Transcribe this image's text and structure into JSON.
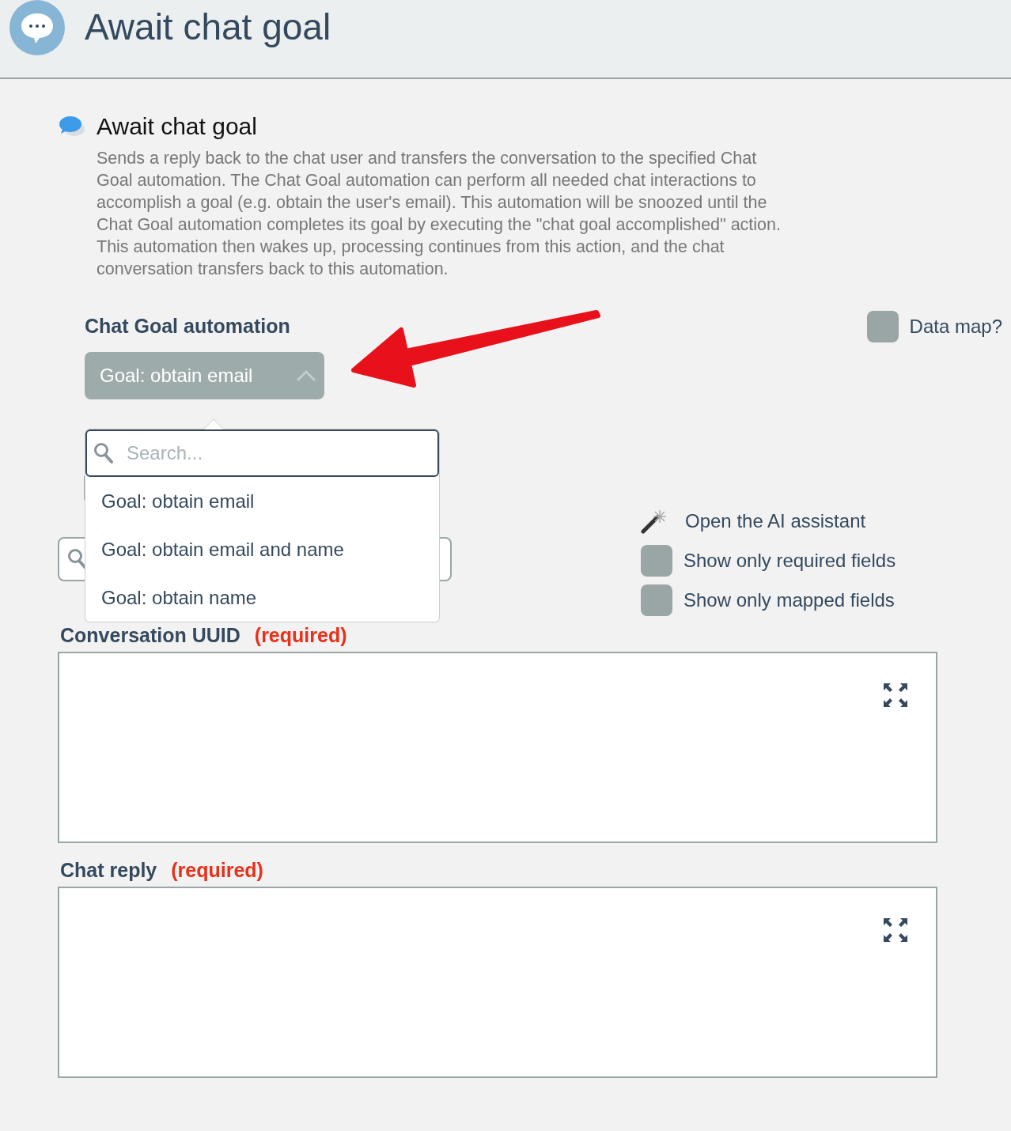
{
  "header": {
    "title": "Await chat goal"
  },
  "action": {
    "title": "Await chat goal",
    "description": "Sends a reply back to the chat user and transfers the conversation to the specified Chat Goal automation. The Chat Goal automation can perform all needed chat interactions to accomplish a goal (e.g. obtain the user's email). This automation will be snoozed until the Chat Goal automation completes its goal by executing the \"chat goal accomplished\" action. This automation then wakes up, processing continues from this action, and the chat conversation transfers back to this automation."
  },
  "chat_goal_automation": {
    "label": "Chat Goal automation",
    "value": "Goal: obtain email",
    "expanded": true,
    "dropdown": {
      "search_placeholder": "Search...",
      "options": [
        {
          "label": "Goal: obtain email"
        },
        {
          "label": "Goal: obtain email and name"
        },
        {
          "label": "Goal: obtain name"
        }
      ]
    }
  },
  "data_map": {
    "label": "Data map?",
    "checked": false
  },
  "ai_assistant": {
    "label": "Open the AI assistant"
  },
  "filters": [
    {
      "label": "Show only required fields",
      "checked": false
    },
    {
      "label": "Show only mapped fields",
      "checked": false
    }
  ],
  "fields": [
    {
      "label": "Conversation UUID",
      "required": "(required)"
    },
    {
      "label": "Chat reply",
      "required": "(required)"
    }
  ]
}
